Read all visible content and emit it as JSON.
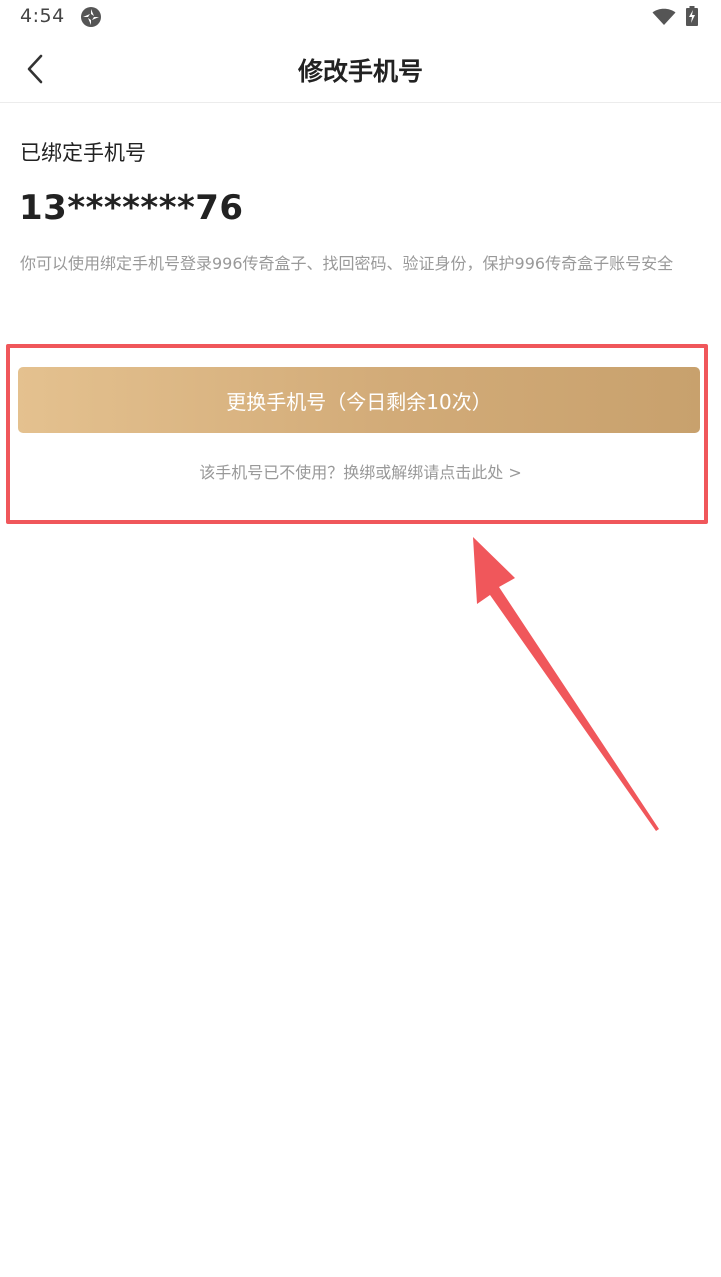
{
  "status_bar": {
    "time": "4:54",
    "app_icon": "spinner-app-icon",
    "wifi_icon": "wifi-icon",
    "battery_icon": "battery-charging-icon"
  },
  "nav": {
    "back_icon": "chevron-left-icon",
    "title": "修改手机号"
  },
  "content": {
    "bound_label": "已绑定手机号",
    "phone_number": "13*******76",
    "description": "你可以使用绑定手机号登录996传奇盒子、找回密码、验证身份，保护996传奇盒子账号安全"
  },
  "actions": {
    "change_button_label": "更换手机号（今日剩余10次）",
    "unbind_link": "该手机号已不使用？换绑或解绑请点击此处 >"
  },
  "annotation": {
    "highlight_color": "#f0575b",
    "arrow_icon": "red-arrow-icon"
  },
  "colors": {
    "button_gradient_start": "#e4c18f",
    "button_gradient_end": "#c8a16d",
    "secondary_text": "#999999"
  }
}
